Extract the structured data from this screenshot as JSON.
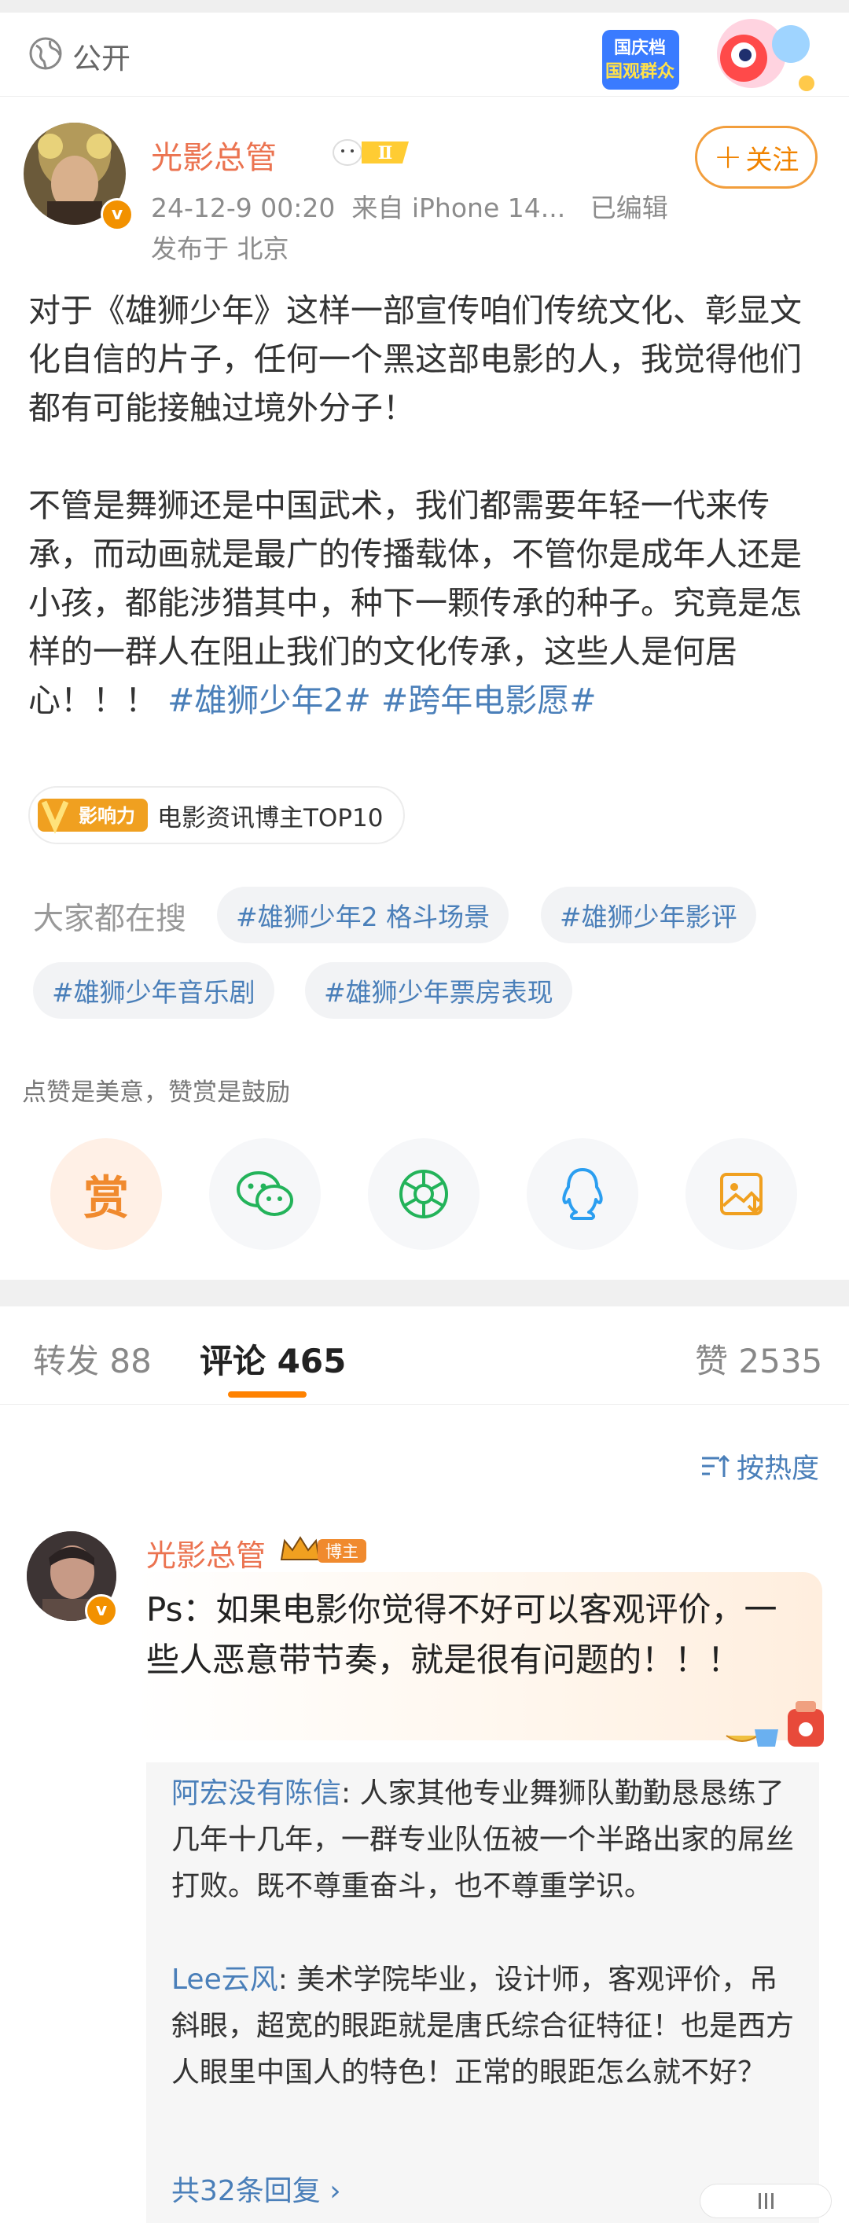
{
  "visibility": {
    "label": "公开",
    "icon": "globe-icon"
  },
  "banner": {
    "line1": "国庆档",
    "line2": "国观群众"
  },
  "post": {
    "author": "光影总管",
    "level_badge": "Ⅱ",
    "time": "24-12-9 00:20",
    "source": "来自 iPhone 14...",
    "edited": "已编辑",
    "location": "发布于 北京",
    "follow_label": "关注",
    "paragraph1": "对于《雄狮少年》这样一部宣传咱们传统文化、彰显文化自信的片子，任何一个黑这部电影的人，我觉得他们都有可能接触过境外分子！",
    "paragraph2": "不管是舞狮还是中国武术，我们都需要年轻一代来传承，而动画就是最广的传播载体，不管你是成年人还是小孩，都能涉猎其中，种下一颗传承的种子。究竟是怎样的一群人在阻止我们的文化传承，这些人是何居心！！！",
    "hashtag1": "#雄狮少年2#",
    "hashtag2": "#跨年电影愿#"
  },
  "influence": {
    "badge_text": "影响力",
    "label": "电影资讯博主TOP10"
  },
  "search": {
    "label": "大家都在搜",
    "chips": [
      "#雄狮少年2 格斗场景",
      "#雄狮少年影评",
      "#雄狮少年音乐剧",
      "#雄狮少年票房表现"
    ]
  },
  "reward": {
    "hint": "点赞是美意，赞赏是鼓励",
    "reward_char": "赏",
    "buttons": [
      "reward-icon",
      "wechat-icon",
      "moments-icon",
      "qq-icon",
      "save-image-icon"
    ]
  },
  "tabs": [
    {
      "label": "转发",
      "count": "88"
    },
    {
      "label": "评论",
      "count": "465"
    },
    {
      "label": "赞",
      "count": "2535"
    }
  ],
  "sort_label": "按热度",
  "comment": {
    "author": "光影总管",
    "badge": "博主",
    "text": "Ps：如果电影你觉得不好可以客观评价，一些人恶意带节奏，就是很有问题的！！！",
    "replies": [
      {
        "name": "阿宏没有陈信",
        "text": ": 人家其他专业舞狮队勤勤恳恳练了几年十几年，一群专业队伍被一个半路出家的屌丝打败。既不尊重奋斗，也不尊重学识。"
      },
      {
        "name": "Lee云风",
        "text": ": 美术学院毕业，设计师，客观评价，吊斜眼，超宽的眼距就是唐氏综合征特征！也是西方人眼里中国人的特色！正常的眼距怎么就不好？"
      }
    ],
    "more_replies": "共32条回复"
  },
  "colors": {
    "accent": "#ff8200",
    "link": "#4a7fb9",
    "name": "#eb7350"
  }
}
